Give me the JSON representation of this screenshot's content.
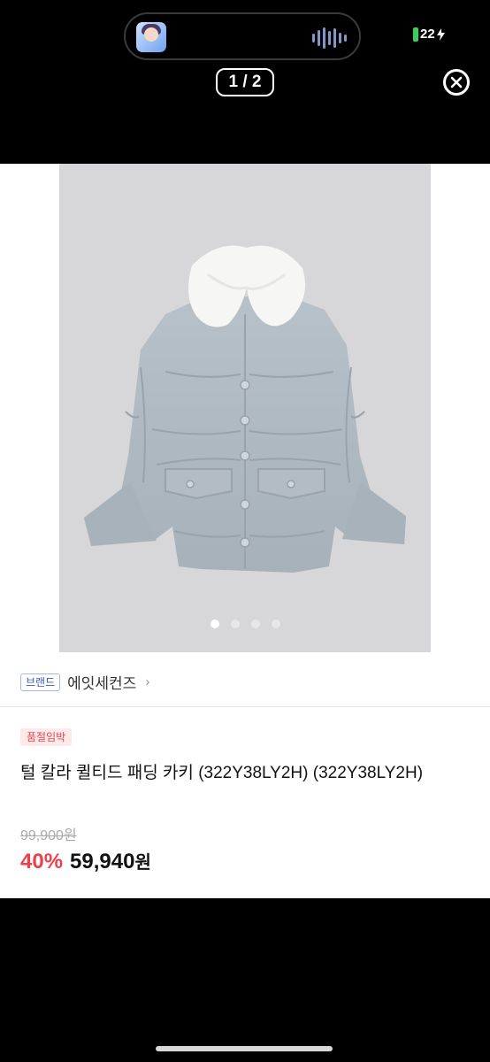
{
  "status": {
    "battery": "22"
  },
  "viewer": {
    "counter": "1 / 2"
  },
  "product": {
    "brand_tag": "브랜드",
    "brand_name": "에잇세컨즈",
    "badge": "품절임박",
    "title": "털 칼라 퀼티드 패딩  카키 (322Y38LY2H) (322Y38LY2H)",
    "original_price": "99,900원",
    "discount": "40%",
    "price": "59,940",
    "currency": "원"
  },
  "gallery": {
    "image_count": 4,
    "active_index": 0
  }
}
